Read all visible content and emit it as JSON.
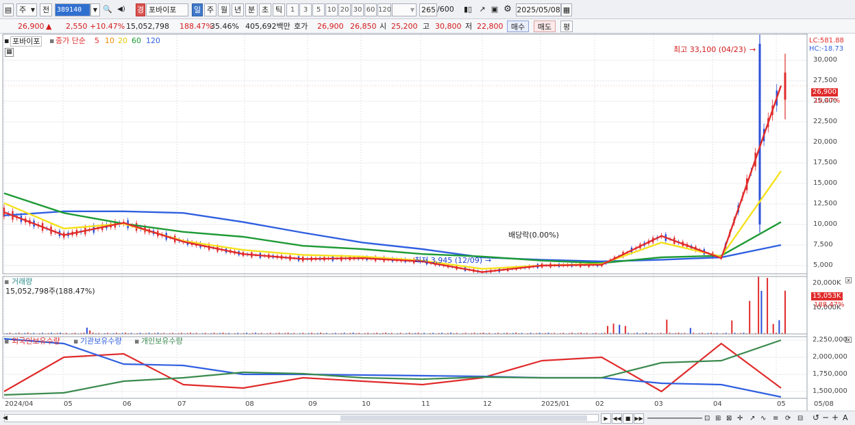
{
  "toolbar": {
    "mode_label": "주",
    "prev_label": "전",
    "stock_code": "389140",
    "market_badge": "경",
    "stock_name": "포바이포",
    "periods": [
      "일",
      "주",
      "월",
      "년",
      "분",
      "초",
      "틱"
    ],
    "active_period": "일",
    "intervals": [
      "1",
      "3",
      "5",
      "10",
      "20",
      "30",
      "60",
      "120"
    ],
    "bar_count": "265",
    "bar_total": "/600",
    "date": "2025/05/08"
  },
  "quote": {
    "price": "26,900",
    "up_arrow": "▲",
    "change": "2,550",
    "change_pct": "+10.47%",
    "volume": "15,052,798",
    "volume_ratio": "188.47%",
    "turnover": "35.46%",
    "amount": "405,692백만",
    "hoga_label": "호가",
    "ask": "26,900",
    "bid": "26,850",
    "open_label": "시",
    "open": "25,200",
    "high_label": "고",
    "high": "30,800",
    "low_label": "저",
    "low": "22,800",
    "buy_label": "매수",
    "sell_label": "매도",
    "eval_label": "평"
  },
  "price_panel": {
    "stock_label": "포바이포",
    "ma_title": "종가 단순",
    "ma_periods": [
      "5",
      "10",
      "20",
      "60",
      "120"
    ],
    "lc": "LC:581.88",
    "hc": "HC:-18.73",
    "high_note": "최고 33,100 (04/23)",
    "low_note": "최저 3,945 (12/09)",
    "dividend_note": "배당락(0.00%)",
    "current_price_tag": "26,900",
    "current_pct_tag": "10.47%",
    "y_ticks": [
      "30,000",
      "27,500",
      "25,000",
      "22,500",
      "20,000",
      "17,500",
      "15,000",
      "12,500",
      "10,000",
      "7,500",
      "5,000"
    ]
  },
  "volume_panel": {
    "title": "거래량",
    "current": "15,052,798주(188.47%)",
    "y_ticks": [
      "20,000K",
      "10,000K"
    ],
    "tag_value": "15,053K",
    "tag_pct": "188.47%"
  },
  "holding_panel": {
    "legend": [
      "외국인보유수량",
      "기관보유수량",
      "개인보유수량"
    ],
    "y_ticks": [
      "2,250,000",
      "2,000,000",
      "1,750,000",
      "1,500,000"
    ]
  },
  "x_axis": [
    "2024/04",
    "05",
    "06",
    "07",
    "08",
    "09",
    "10",
    "11",
    "12",
    "2025/01",
    "02",
    "03",
    "04",
    "05"
  ],
  "x_axis_end": "05/08",
  "colors": {
    "up": "#e02b2b",
    "down": "#2a4fd8",
    "ma5": "#e02b2b",
    "ma10": "#f08a00",
    "ma20": "#f5e11c",
    "ma60": "#1d9a35",
    "ma120": "#2f5fe0",
    "foreign": "#e02b2b",
    "institution": "#3b8a4e",
    "individual": "#2f5fe0"
  },
  "chart_data": {
    "type": "line",
    "x": [
      "2024/04",
      "05",
      "06",
      "07",
      "08",
      "09",
      "10",
      "11",
      "12",
      "2025/01",
      "02",
      "03",
      "04",
      "05"
    ],
    "series": [
      {
        "name": "120",
        "values": [
          11100,
          11600,
          11600,
          11400,
          10300,
          9000,
          7800,
          7000,
          6000,
          5700,
          5500,
          5700,
          6000,
          7500
        ]
      },
      {
        "name": "60",
        "values": [
          13800,
          11400,
          10100,
          9100,
          8500,
          7400,
          7000,
          6400,
          6100,
          5600,
          5300,
          6000,
          6200,
          10300
        ]
      },
      {
        "name": "20",
        "values": [
          12600,
          9500,
          10100,
          8000,
          6900,
          6300,
          6100,
          5600,
          4600,
          5000,
          5200,
          7800,
          6100,
          16500
        ]
      },
      {
        "name": "종가",
        "values": [
          11500,
          8700,
          10200,
          7900,
          6400,
          5800,
          5900,
          5500,
          4200,
          5000,
          5100,
          8600,
          5900,
          26900
        ]
      }
    ],
    "price_ylim": [
      4000,
      32000
    ],
    "volume_ylim_k": [
      0,
      20000
    ],
    "holding_ylim": [
      1400000,
      2300000
    ],
    "annotations": [
      "최고 33,100 (04/23)",
      "최저 3,945 (12/09)",
      "배당락(0.00%)"
    ]
  }
}
